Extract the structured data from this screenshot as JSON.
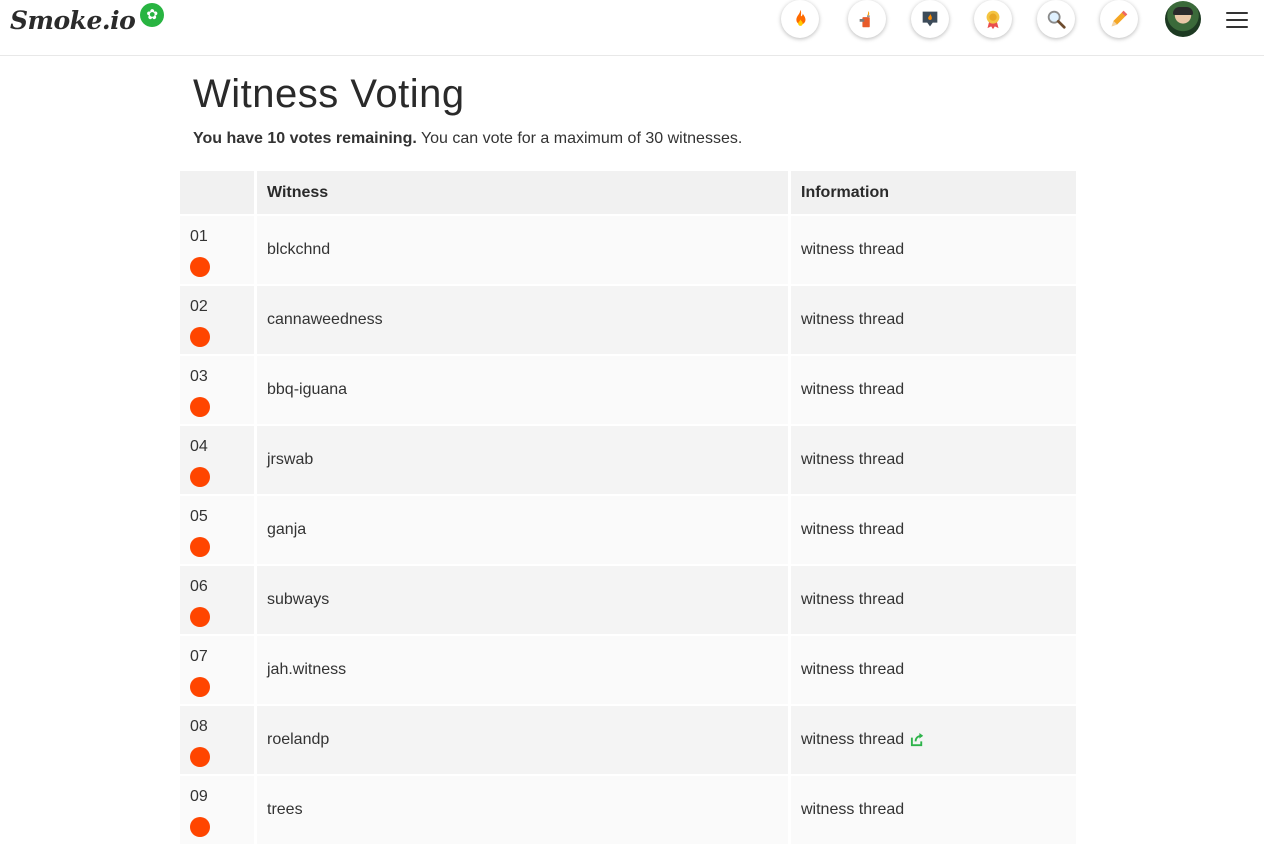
{
  "header": {
    "logo_text": "Smoke.io",
    "logo_badge_icon": "cannabis-leaf-icon",
    "nav_icons": [
      "fire-icon",
      "lighter-icon",
      "pin-icon",
      "award-icon",
      "search-icon",
      "pencil-icon"
    ],
    "menu_icon": "hamburger-menu-icon"
  },
  "main": {
    "title": "Witness Voting",
    "votes_bold": "You have 10 votes remaining.",
    "votes_rest": " You can vote for a maximum of 30 witnesses.",
    "table": {
      "headers": [
        "",
        "Witness",
        "Information"
      ],
      "rows": [
        {
          "rank": "01",
          "name": "blckchnd",
          "info": "witness thread",
          "external": false
        },
        {
          "rank": "02",
          "name": "cannaweedness",
          "info": "witness thread",
          "external": false
        },
        {
          "rank": "03",
          "name": "bbq-iguana",
          "info": "witness thread",
          "external": false
        },
        {
          "rank": "04",
          "name": "jrswab",
          "info": "witness thread",
          "external": false
        },
        {
          "rank": "05",
          "name": "ganja",
          "info": "witness thread",
          "external": false
        },
        {
          "rank": "06",
          "name": "subways",
          "info": "witness thread",
          "external": false
        },
        {
          "rank": "07",
          "name": "jah.witness",
          "info": "witness thread",
          "external": false
        },
        {
          "rank": "08",
          "name": "roelandp",
          "info": "witness thread",
          "external": true
        },
        {
          "rank": "09",
          "name": "trees",
          "info": "witness thread",
          "external": false
        }
      ]
    }
  },
  "colors": {
    "vote_dot": "#ff4500",
    "logo_leaf": "#28b441",
    "external_link": "#2db34a"
  }
}
